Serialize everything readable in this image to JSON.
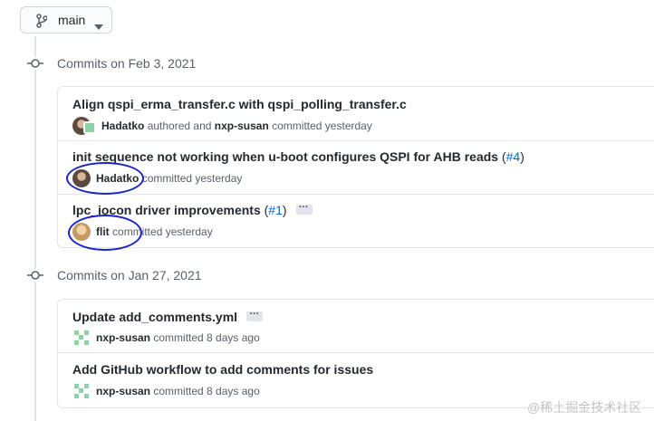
{
  "branch": {
    "label": "main"
  },
  "groups": [
    {
      "heading": "Commits on Feb 3, 2021",
      "commits": [
        {
          "title": "Align qspi_erma_transfer.c with qspi_polling_transfer.c",
          "author": "Hadatko",
          "middle": "authored and",
          "committer": "nxp-susan",
          "suffix": "committed yesterday"
        },
        {
          "title": "init sequence not working when u-boot configures QSPI for AHB reads",
          "pr_open": "(",
          "pr": "#4",
          "pr_close": ")",
          "author": "Hadatko",
          "suffix": "committed yesterday"
        },
        {
          "title": "lpc_iocon driver improvements",
          "pr_open": "(",
          "pr": "#1",
          "pr_close": ")",
          "author": "flit",
          "suffix": "committed yesterday"
        }
      ]
    },
    {
      "heading": "Commits on Jan 27, 2021",
      "commits": [
        {
          "title": "Update add_comments.yml",
          "author": "nxp-susan",
          "suffix": "committed 8 days ago"
        },
        {
          "title": "Add GitHub workflow to add comments for issues",
          "author": "nxp-susan",
          "suffix": "committed 8 days ago"
        }
      ]
    }
  ],
  "watermark": "@稀土掘金技术社区",
  "colors": {
    "annotation": "#1a24c9",
    "link": "#0366d6"
  }
}
